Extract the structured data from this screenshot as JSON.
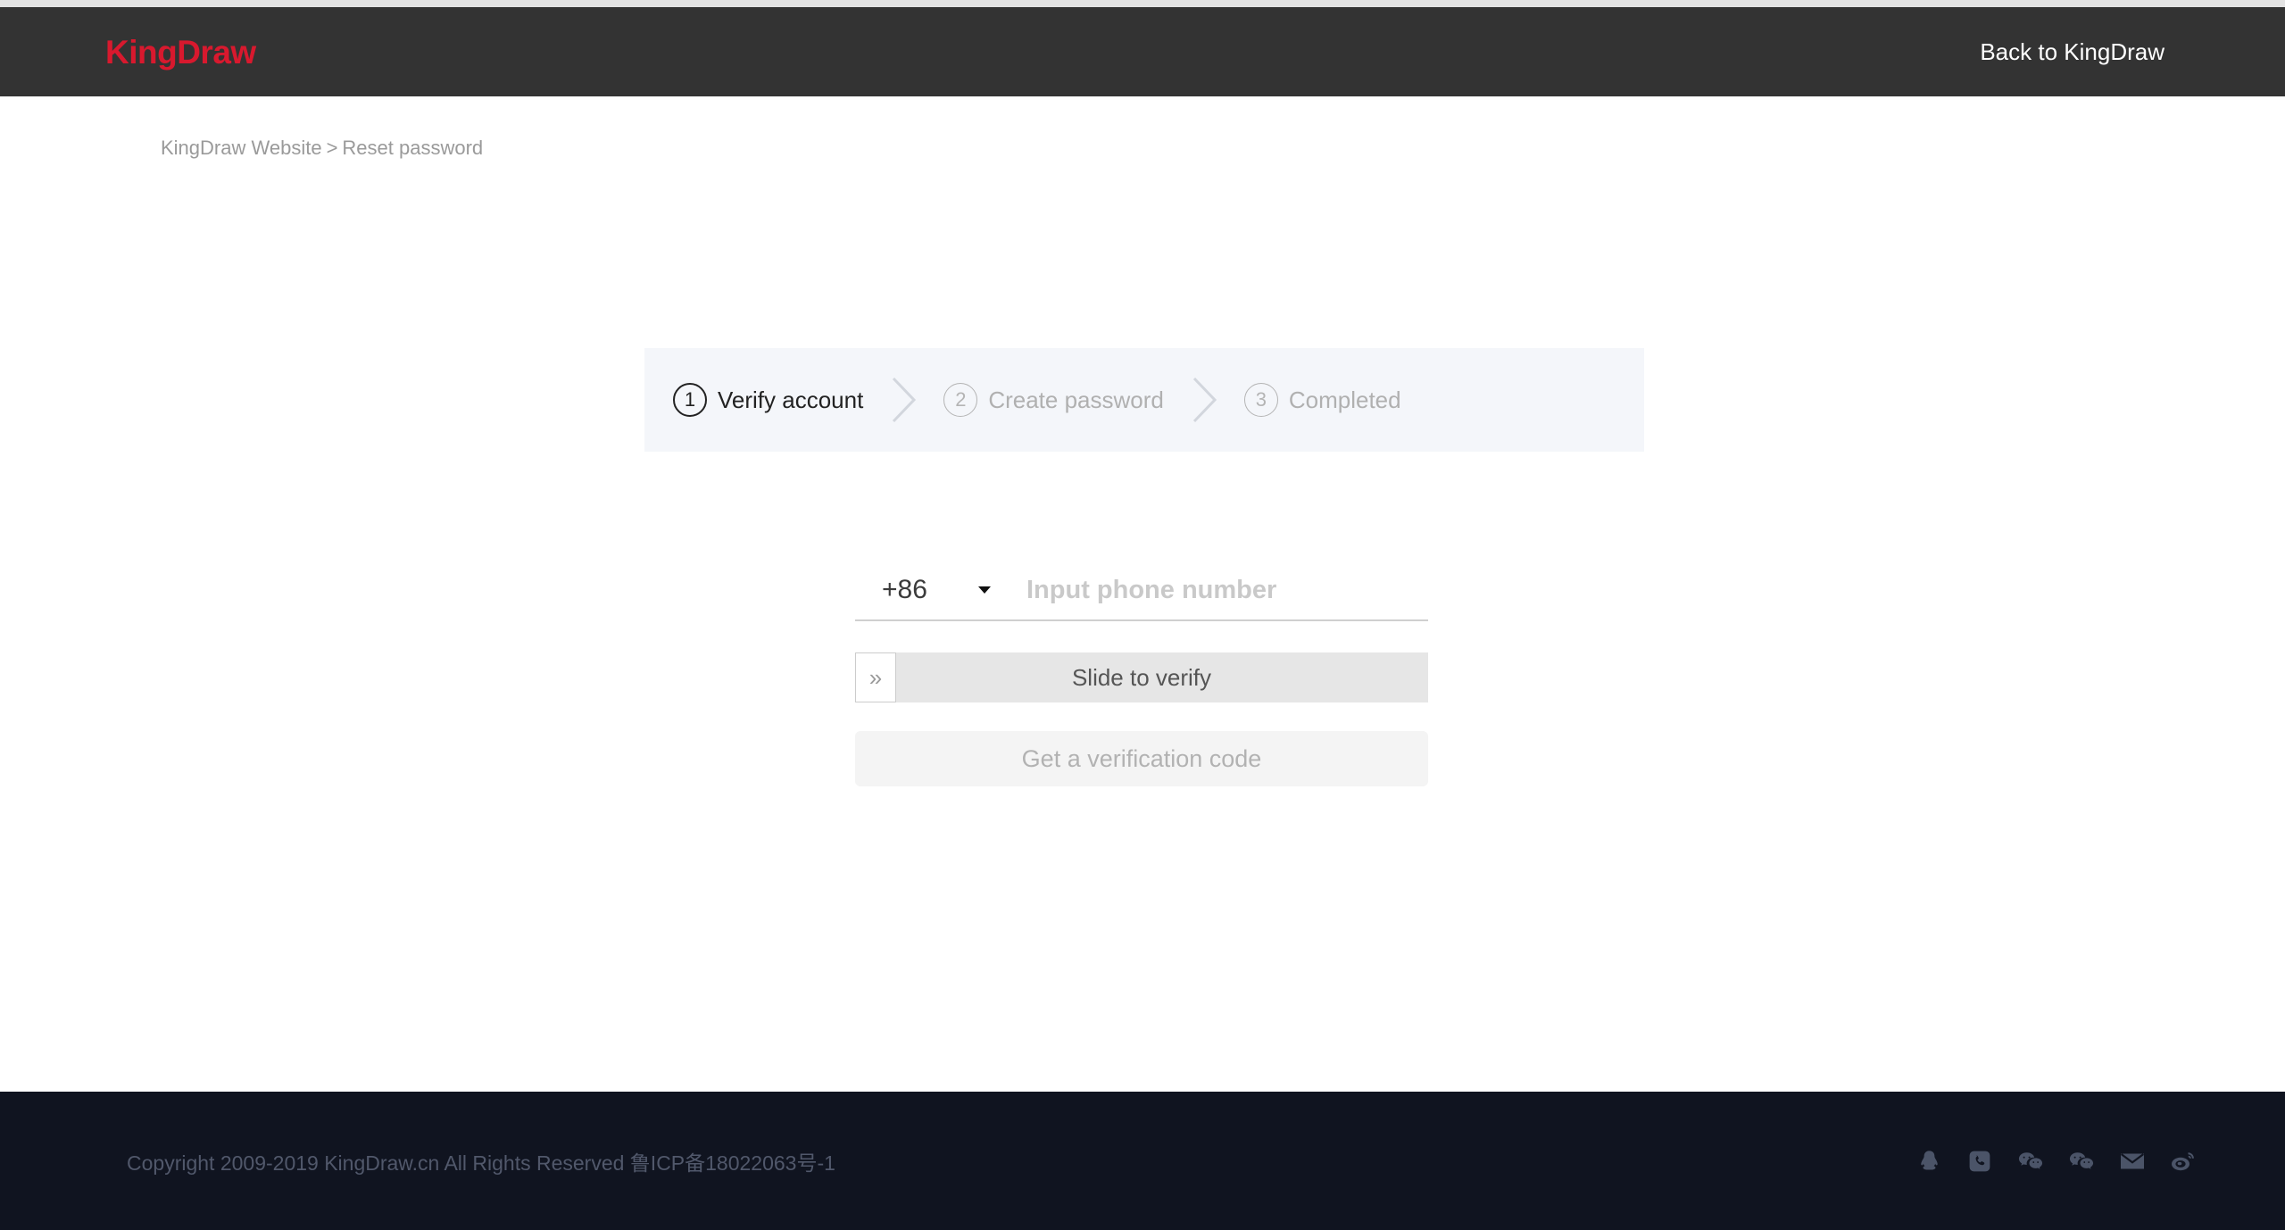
{
  "header": {
    "logo_text": "KingDraw",
    "logo_color": "#d8192e",
    "background_color": "#333333",
    "back_link": "Back to KingDraw"
  },
  "breadcrumb": {
    "root": "KingDraw Website",
    "separator": ">",
    "current": "Reset password"
  },
  "steps": {
    "background_color": "#f4f6fa",
    "items": [
      {
        "number": "1",
        "label": "Verify account",
        "state": "active"
      },
      {
        "number": "2",
        "label": "Create password",
        "state": "inactive"
      },
      {
        "number": "3",
        "label": "Completed",
        "state": "inactive"
      }
    ],
    "separator_icon": "chevron-right-icon"
  },
  "form": {
    "country_code": {
      "value": "+86",
      "caret_icon": "caret-down-icon"
    },
    "phone": {
      "value": "",
      "placeholder": "Input phone number"
    },
    "slider": {
      "label": "Slide to verify",
      "handle_icon": "double-chevron-right-icon",
      "handle_glyph": "»",
      "track_color": "#e6e6e6"
    },
    "get_code_button": {
      "label": "Get a verification code",
      "state": "disabled",
      "background_color": "#f4f4f4",
      "text_color": "#b2b2b2"
    }
  },
  "footer": {
    "background_color": "#101420",
    "copyright": "Copyright 2009-2019 KingDraw.cn All Rights Reserved 鲁ICP备18022063号-1",
    "social_icons": [
      {
        "name": "qq-icon"
      },
      {
        "name": "phone-icon"
      },
      {
        "name": "wechat-icon"
      },
      {
        "name": "wechat-work-icon"
      },
      {
        "name": "email-icon"
      },
      {
        "name": "weibo-icon"
      }
    ]
  }
}
